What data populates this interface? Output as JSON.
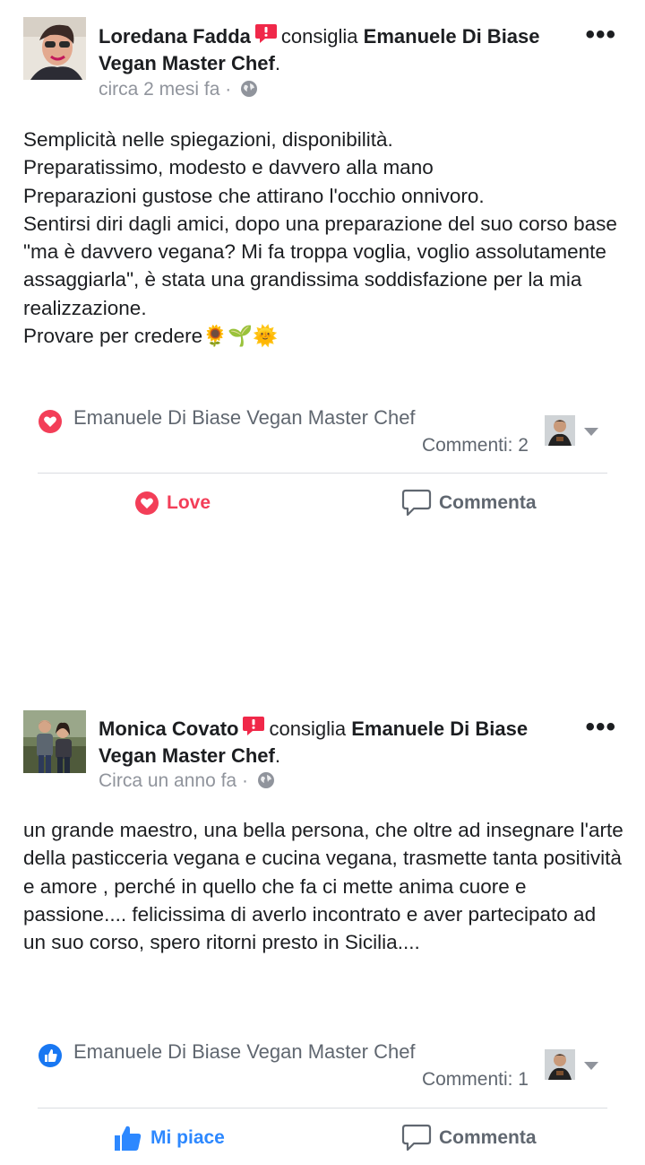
{
  "colors": {
    "love": "#f33e58",
    "like": "#1877f2",
    "text": "#1c1e21",
    "secondary": "#90949c",
    "divider": "#dadde1"
  },
  "posts": [
    {
      "author": "Loredana Fadda",
      "verb": "consiglia",
      "page": "Emanuele Di Biase Vegan Master Chef",
      "period": ".",
      "time": "circa 2 mesi fa",
      "dot": "·",
      "more": "•••",
      "body": "Semplicità nelle spiegazioni, disponibilità.\nPreparatissimo, modesto e davvero alla mano\nPreparazioni gustose che attirano l'occhio onnivoro.\nSentirsi diri dagli amici, dopo una preparazione del suo corso base \"ma è davvero vegana? Mi fa troppa voglia, voglio assolutamente assaggiarla\", è stata una grandissima soddisfazione per la mia realizzazione.\nProvare per credere🌻🌱🌞",
      "reaction_icon": "love-reaction-icon",
      "reaction_name": "Emanuele Di Biase Vegan Master Chef",
      "comments": "Commenti: 2",
      "action_primary": "Love",
      "action_comment": "Commenta"
    },
    {
      "author": "Monica Covato",
      "verb": "consiglia",
      "page": "Emanuele Di Biase Vegan Master Chef",
      "period": ".",
      "time": "Circa un anno fa",
      "dot": "·",
      "more": "•••",
      "body": "un grande maestro, una bella persona, che oltre ad insegnare l'arte della pasticceria vegana e cucina vegana, trasmette tanta positività e amore , perché in quello che fa ci mette anima cuore e passione.... felicissima di averlo incontrato e aver partecipato ad un suo corso, spero ritorni presto in Sicilia....",
      "reaction_icon": "like-reaction-icon",
      "reaction_name": "Emanuele Di Biase Vegan Master Chef",
      "comments": "Commenti: 1",
      "action_primary": "Mi piace",
      "action_comment": "Commenta"
    }
  ]
}
